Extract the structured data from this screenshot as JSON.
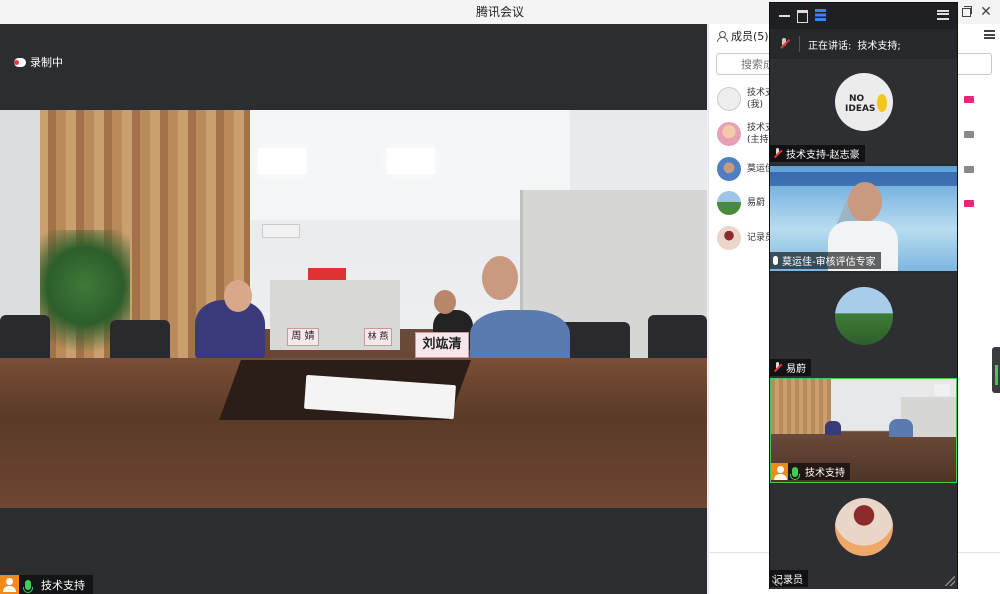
{
  "window": {
    "title": "腾讯会议"
  },
  "main": {
    "recording_label": "录制中",
    "speaker_label": "技术支持",
    "nameplates": [
      "周 婧",
      "林 燕",
      "刘竑清"
    ]
  },
  "members_panel": {
    "tab_label": "成员(5)",
    "search_placeholder": "搜索成员",
    "members": [
      {
        "name": "技术支",
        "sub": "(我)"
      },
      {
        "name": "技术支",
        "sub": "(主持"
      },
      {
        "name": "莫运佳",
        "sub": ""
      },
      {
        "name": "易蔚",
        "sub": ""
      },
      {
        "name": "记录员",
        "sub": ""
      }
    ]
  },
  "gallery": {
    "speaking_prefix": "正在讲话:",
    "speaking_name": "技术支持;",
    "tiles": [
      {
        "name": "技术支持-赵志豪"
      },
      {
        "name": "莫运佳-审核评估专家"
      },
      {
        "name": "易蔚"
      },
      {
        "name": "技术支持"
      },
      {
        "name": "记录员"
      }
    ],
    "more_label": "···"
  },
  "colors": {
    "accent": "#3b82f6",
    "speaking_green": "#3fce5a",
    "badge_orange": "#f08a1c"
  }
}
